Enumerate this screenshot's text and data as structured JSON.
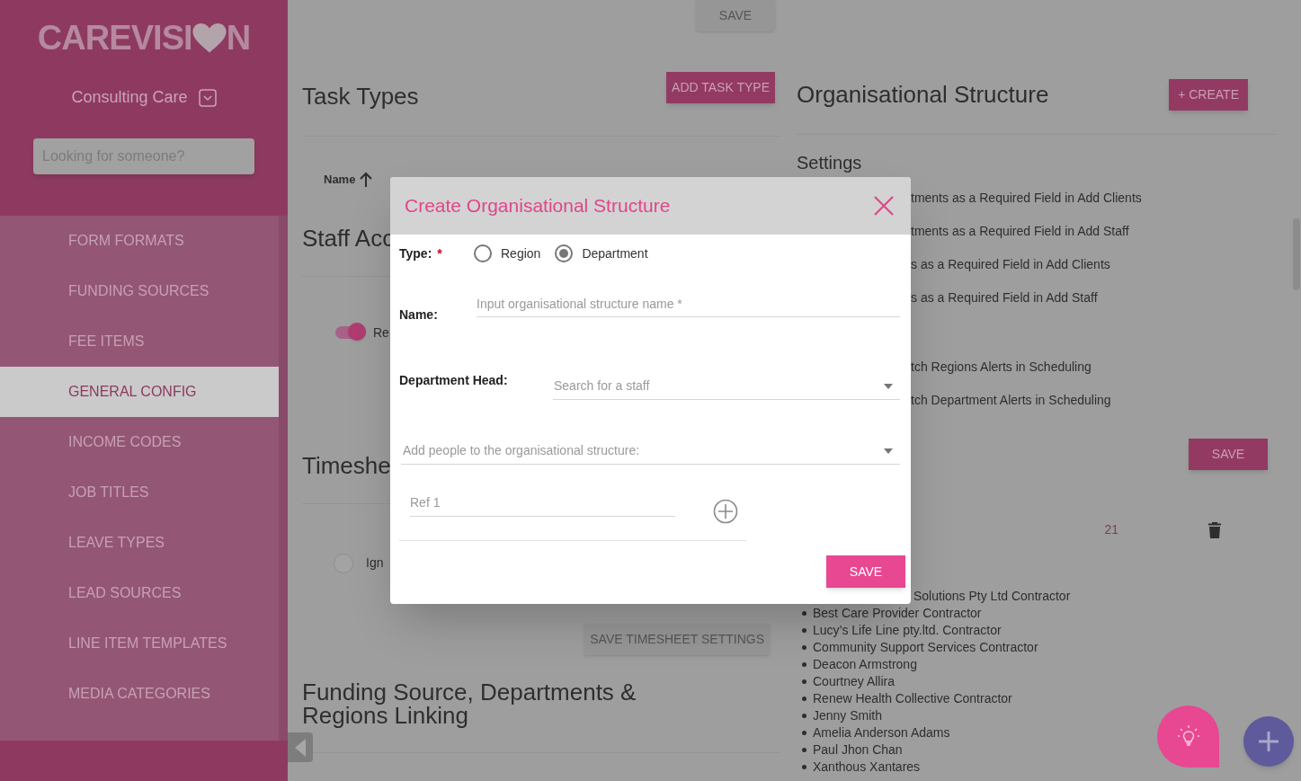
{
  "sidebar": {
    "logo": {
      "before": "CAREVISI",
      "after": "N"
    },
    "org_switcher": "Consulting Care",
    "search": {
      "placeholder": "Looking for someone?"
    },
    "items": [
      {
        "label": "FORM FORMATS",
        "selected": false
      },
      {
        "label": "FUNDING SOURCES",
        "selected": false
      },
      {
        "label": "FEE ITEMS",
        "selected": false
      },
      {
        "label": "GENERAL CONFIG",
        "selected": true
      },
      {
        "label": "INCOME CODES",
        "selected": false
      },
      {
        "label": "JOB TITLES",
        "selected": false
      },
      {
        "label": "LEAVE TYPES",
        "selected": false
      },
      {
        "label": "LEAD SOURCES",
        "selected": false
      },
      {
        "label": "LINE ITEM TEMPLATES",
        "selected": false
      },
      {
        "label": "MEDIA CATEGORIES",
        "selected": false
      }
    ]
  },
  "left": {
    "top_save": {
      "label": "SAVE",
      "disabled": true
    },
    "task_types": {
      "title": "Task Types",
      "button": "ADD TASK TYPE",
      "column": "Name"
    },
    "staff_access": {
      "title": "Staff Acc",
      "toggle": {
        "label": "Re",
        "on": true
      }
    },
    "timesheet": {
      "title": "Timeshe",
      "option": {
        "label": "Ign",
        "selected": false
      },
      "save": {
        "label": "SAVE TIMESHEET SETTINGS",
        "disabled": true
      }
    },
    "funding": {
      "title": "Funding Source, Departments & Regions Linking"
    }
  },
  "right": {
    "title": "Organisational Structure",
    "create": "+ CREATE",
    "settings_title": "Settings",
    "settings": [
      "tments as a Required Field in Add Clients",
      "tments as a Required Field in Add Staff",
      "s as a Required Field in Add Clients",
      "s as a Required Field in Add Staff",
      "tch Regions Alerts in Scheduling",
      "tch Department Alerts in Scheduling"
    ],
    "save": "SAVE",
    "count": "21",
    "first_contractor": "Solutions Pty Ltd Contractor",
    "contractors": [
      "Best Care Provider Contractor",
      "Lucy’s Life Line pty.ltd. Contractor",
      "Community Support Services Contractor",
      "Deacon Armstrong",
      "Courtney Allira",
      "Renew Health Collective Contractor",
      "Jenny Smith",
      "Amelia Anderson Adams",
      "Paul Jhon Chan",
      "Xanthous Xantares"
    ]
  },
  "modal": {
    "title": "Create Organisational Structure",
    "type_label": "Type:",
    "required": "*",
    "types": [
      {
        "label": "Region",
        "selected": false
      },
      {
        "label": "Department",
        "selected": true
      }
    ],
    "name_label": "Name:",
    "name_placeholder": "Input organisational structure name *",
    "head_label": "Department Head:",
    "head_placeholder": "Search for a staff",
    "people_placeholder": "Add people to the organisational structure:",
    "ref_placeholder": "Ref 1",
    "save": "SAVE"
  }
}
